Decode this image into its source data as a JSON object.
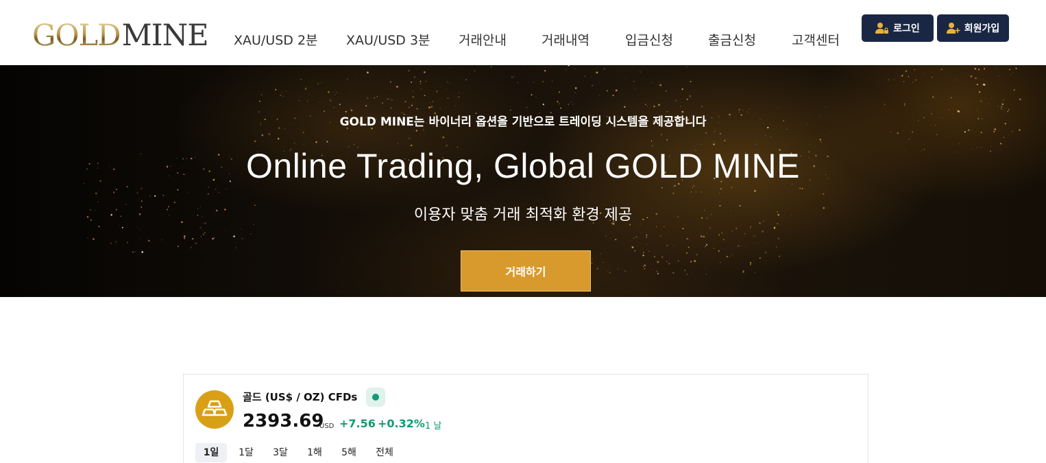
{
  "header": {
    "logo": {
      "part1": "GOLD",
      "part2": "MINE"
    },
    "nav": [
      {
        "label": "XAU/USD 2분"
      },
      {
        "label": "XAU/USD 3분"
      },
      {
        "label": "거래안내"
      },
      {
        "label": "거래내역"
      },
      {
        "label": "입금신청"
      },
      {
        "label": "출금신청"
      },
      {
        "label": "고객센터"
      }
    ],
    "login_label": "로그인",
    "signup_label": "회원가입",
    "button_color": "#1a2744"
  },
  "hero": {
    "subtitle": "GOLD MINE는 바이너리 옵션을 기반으로 트레이딩 시스템을 제공합니다",
    "title": "Online Trading, Global GOLD MINE",
    "tagline": "이용자 맞춤 거래 최적화 환경 제공",
    "cta_label": "거래하기",
    "cta_color": "#d89a2c"
  },
  "widget": {
    "title": "골드 (US$ / OZ) CFDs",
    "price": "2393.69",
    "unit": "USD",
    "change": "+7.56",
    "change_pct": "+0.32%",
    "period": "1 날",
    "ranges": [
      {
        "label": "1일",
        "active": true
      },
      {
        "label": "1달",
        "active": false
      },
      {
        "label": "3달",
        "active": false
      },
      {
        "label": "1해",
        "active": false
      },
      {
        "label": "5해",
        "active": false
      },
      {
        "label": "전체",
        "active": false
      }
    ],
    "positive_color": "#129a72",
    "coin_color": "#d9a017"
  }
}
